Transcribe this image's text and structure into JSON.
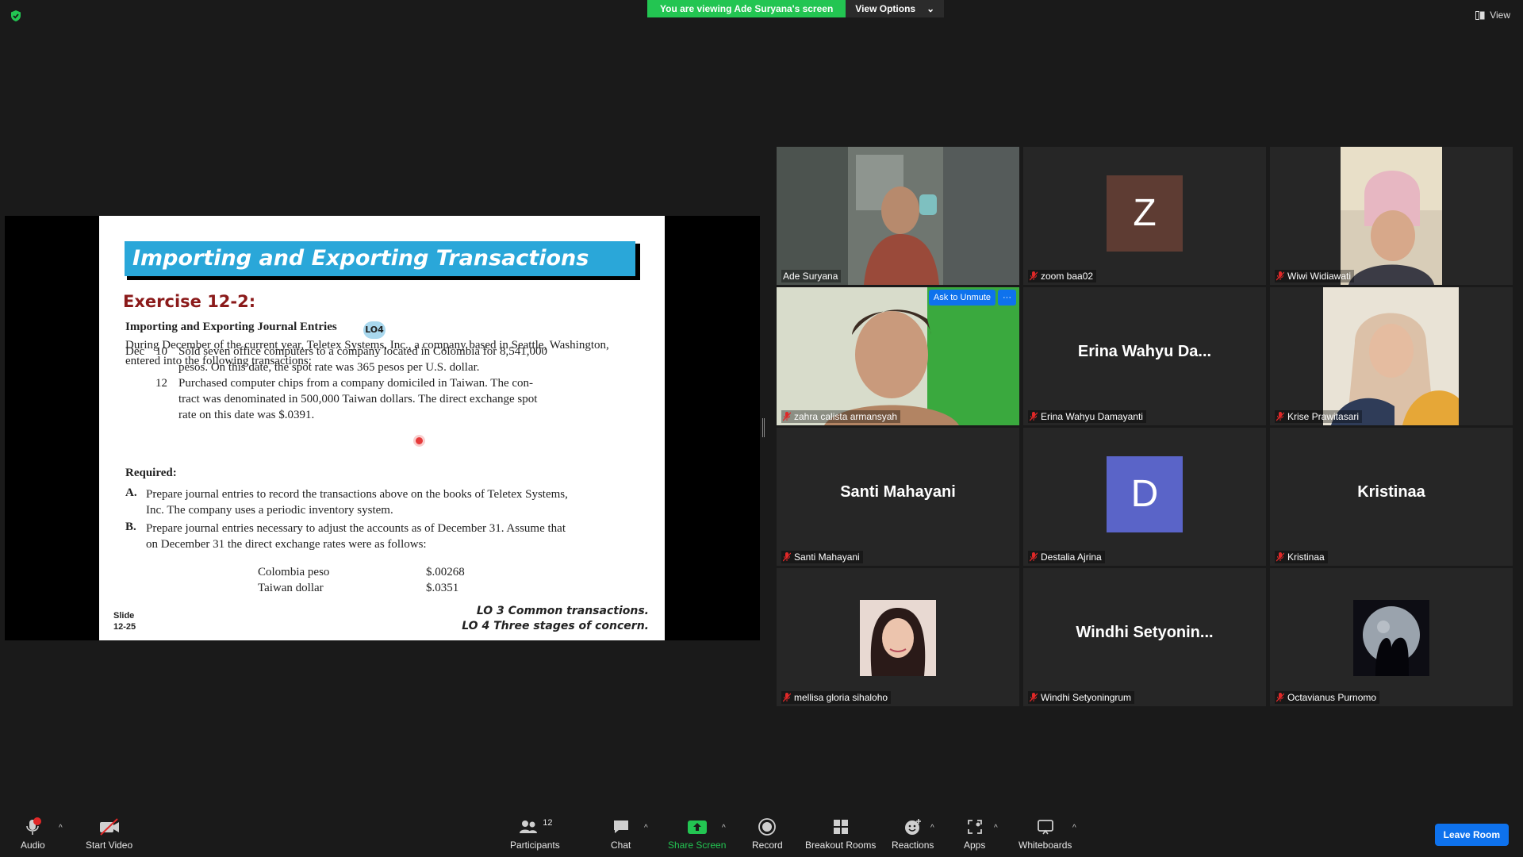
{
  "top": {
    "viewing_text": "You are viewing Ade Suryana's screen",
    "view_options": "View Options",
    "view_button": "View",
    "shield_icon": "shield-check-icon"
  },
  "slide": {
    "title": "Importing and Exporting Transactions",
    "exercise": "Exercise 12-2:",
    "subhead": "Importing and Exporting Journal Entries",
    "lo_badge": "LO4",
    "intro": "During December of the current year, Teletex Systems, Inc., a company based in Seattle, Washington, entered into the following transactions:",
    "transactions": [
      {
        "month": "Dec",
        "day": "10",
        "line1": "Sold seven office computers to a company located in Colombia for 8,541,000",
        "line2": "pesos. On this date, the spot rate was 365 pesos per U.S. dollar.",
        "line3": ""
      },
      {
        "month": "",
        "day": "12",
        "line1": "Purchased computer chips from a company domiciled in Taiwan. The con-",
        "line2": "tract was denominated in 500,000 Taiwan dollars. The direct exchange spot",
        "line3": "rate on this date was $.0391."
      }
    ],
    "required_label": "Required:",
    "required": [
      {
        "letter": "A.",
        "line1": "Prepare journal entries to record the transactions above on the books of Teletex Systems,",
        "line2": "Inc. The company uses a periodic inventory system."
      },
      {
        "letter": "B.",
        "line1": "Prepare journal entries necessary to adjust the accounts as of December 31. Assume that",
        "line2": "on December 31 the direct exchange rates were as follows:"
      }
    ],
    "rates": [
      {
        "name": "Colombia peso",
        "value": "$.00268"
      },
      {
        "name": "Taiwan dollar",
        "value": "$.0351"
      }
    ],
    "slide_label": "Slide",
    "slide_number": "12-25",
    "lo3": "LO 3  Common transactions.",
    "lo4": "LO 4  Three stages of concern."
  },
  "participants": [
    {
      "name": "Ade Suryana",
      "type": "video",
      "active": true,
      "muted": false
    },
    {
      "name": "zoom baa02",
      "type": "avatar",
      "initial": "Z",
      "color": "#5e3c33",
      "muted": true
    },
    {
      "name": "Wiwi Widiawati",
      "type": "photo",
      "muted": true
    },
    {
      "name": "zahra calista armansyah",
      "type": "video",
      "muted": true,
      "ask_unmute": "Ask to Unmute",
      "more": "···"
    },
    {
      "name": "Erina Wahyu Damayanti",
      "type": "name",
      "display": "Erina  Wahyu  Da...",
      "muted": true
    },
    {
      "name": "Krise Prawitasari",
      "type": "photo",
      "muted": true
    },
    {
      "name": "Santi Mahayani",
      "type": "name",
      "display": "Santi Mahayani",
      "muted": true
    },
    {
      "name": "Destalia Ajrina",
      "type": "avatar",
      "initial": "D",
      "color": "#5a64c8",
      "muted": true
    },
    {
      "name": "Kristinaa",
      "type": "name",
      "display": "Kristinaa",
      "muted": true
    },
    {
      "name": "mellisa gloria sihaloho",
      "type": "photo",
      "muted": true
    },
    {
      "name": "Windhi Setyoningrum",
      "type": "name",
      "display": "Windhi  Setyonin...",
      "muted": true
    },
    {
      "name": "Octavianus Purnomo",
      "type": "photo",
      "muted": true
    }
  ],
  "toolbar": {
    "audio": "Audio",
    "audio_badge": "!",
    "start_video": "Start Video",
    "participants": "Participants",
    "participants_count": "12",
    "chat": "Chat",
    "share_screen": "Share Screen",
    "record": "Record",
    "breakout_rooms": "Breakout Rooms",
    "reactions": "Reactions",
    "apps": "Apps",
    "whiteboards": "Whiteboards",
    "leave": "Leave Room"
  },
  "colors": {
    "share_green": "#23c552",
    "accent_blue": "#0e72ed",
    "active_speaker": "#d4e14b",
    "muted_red": "#e02828"
  }
}
